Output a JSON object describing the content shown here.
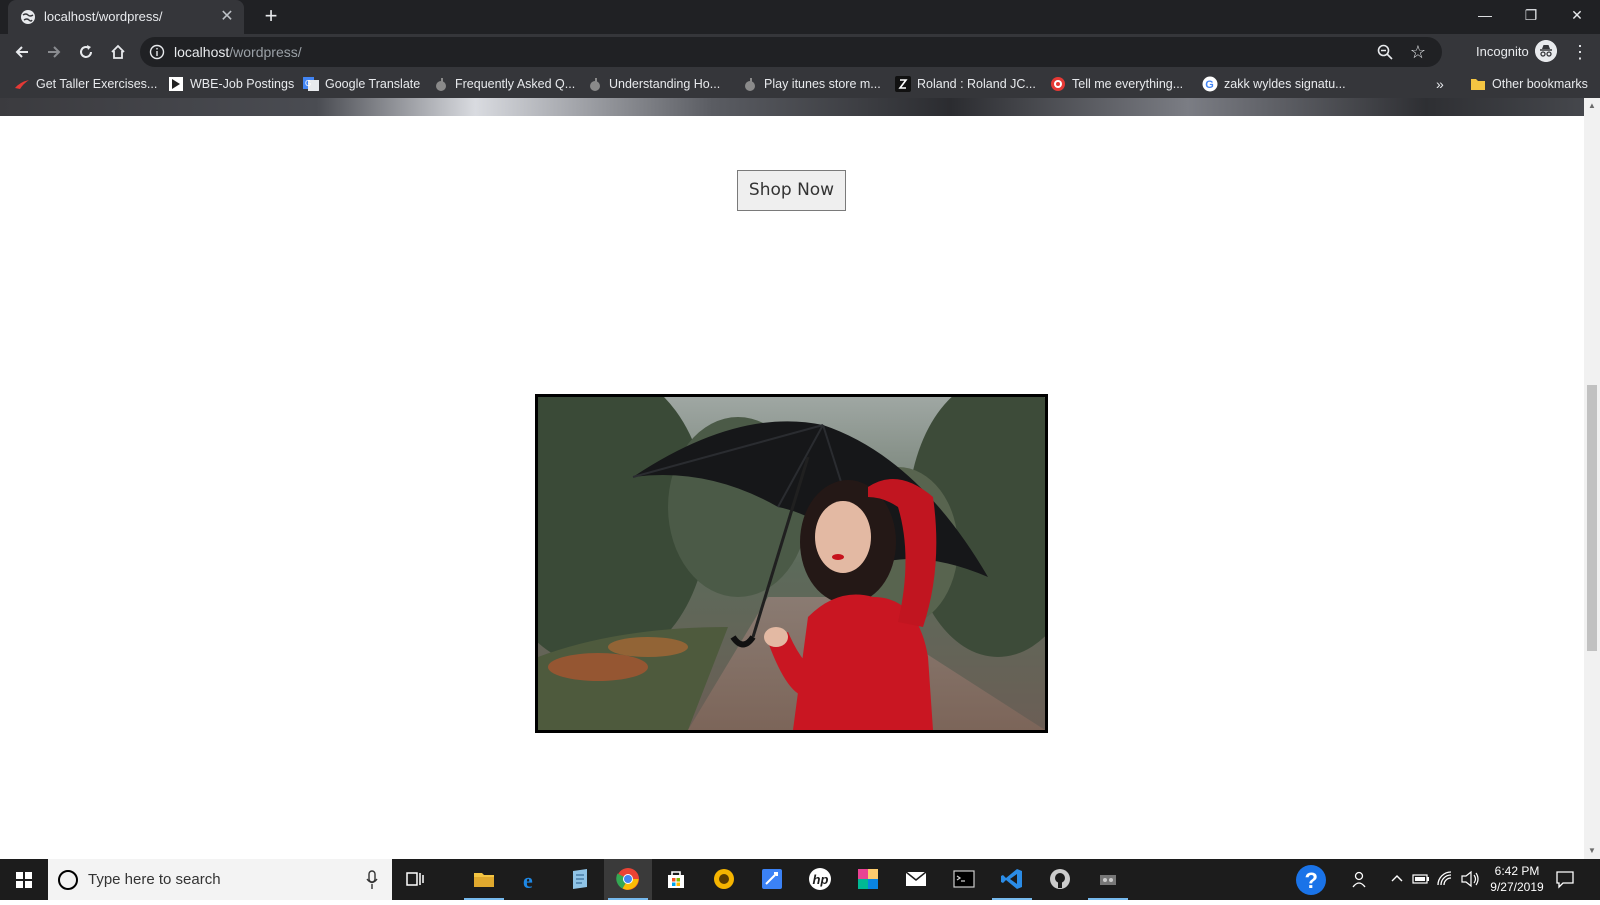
{
  "browser": {
    "tab": {
      "title": "localhost/wordpress/",
      "close_glyph": "✕"
    },
    "new_tab_glyph": "+",
    "window_controls": {
      "minimize": "—",
      "restore": "❐",
      "close": "✕"
    },
    "url": {
      "host": "localhost",
      "path": "/wordpress/"
    },
    "incognito_label": "Incognito",
    "bookmarks": [
      {
        "label": "Get Taller Exercises...",
        "icon": "red-swoosh-icon",
        "color": "#e53935"
      },
      {
        "label": "WBE-Job Postings",
        "icon": "flag-icon",
        "color": "#ffffff"
      },
      {
        "label": "Google Translate",
        "icon": "google-translate-icon",
        "color": "#4285f4"
      },
      {
        "label": "Frequently Asked Q...",
        "icon": "apple-icon",
        "color": "#8a8a8a"
      },
      {
        "label": "Understanding Ho...",
        "icon": "apple-icon",
        "color": "#8a8a8a"
      },
      {
        "label": "Play itunes store m...",
        "icon": "apple-icon",
        "color": "#8a8a8a"
      },
      {
        "label": "Roland : Roland JC...",
        "icon": "roland-icon",
        "color": "#ffffff"
      },
      {
        "label": "Tell me everything...",
        "icon": "target-icon",
        "color": "#e53935"
      },
      {
        "label": "zakk wyldes signatu...",
        "icon": "google-icon",
        "color": "#ffffff"
      }
    ],
    "bookmarks_overflow": "»",
    "other_bookmarks": "Other bookmarks"
  },
  "page": {
    "shop_button_label": "Shop Now",
    "hero_image": "woman-with-umbrella-photo"
  },
  "taskbar": {
    "search_placeholder": "Type here to search",
    "apps": [
      {
        "name": "file-explorer-icon",
        "color": "#f4c542"
      },
      {
        "name": "edge-icon",
        "color": "#1e88e5"
      },
      {
        "name": "notepad-icon",
        "color": "#8fc3e6"
      },
      {
        "name": "chrome-icon",
        "color": "#ea4335",
        "active": true
      },
      {
        "name": "store-icon",
        "color": "#ffffff"
      },
      {
        "name": "app-yellow-icon",
        "color": "#f5b400"
      },
      {
        "name": "sticky-icon",
        "color": "#3b82f6"
      },
      {
        "name": "hp-icon",
        "color": "#ffffff"
      },
      {
        "name": "paint-icon",
        "color": "#e84393"
      },
      {
        "name": "mail-icon",
        "color": "#ffffff"
      },
      {
        "name": "terminal-icon",
        "color": "#cccccc"
      },
      {
        "name": "vscode-icon",
        "color": "#2b8ce6"
      },
      {
        "name": "github-icon",
        "color": "#cccccc"
      },
      {
        "name": "app-misc-icon",
        "color": "#cccccc"
      }
    ],
    "clock_time": "6:42 PM",
    "clock_date": "9/27/2019"
  }
}
